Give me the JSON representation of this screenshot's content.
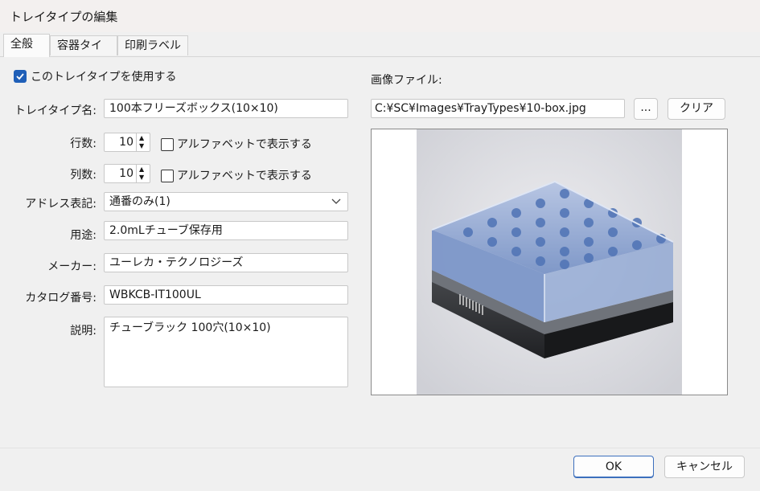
{
  "window": {
    "title": "トレイタイプの編集"
  },
  "tabs": [
    {
      "label": "全般",
      "active": true
    },
    {
      "label": "容器タイプ",
      "active": false
    },
    {
      "label": "印刷ラベル",
      "active": false
    }
  ],
  "general": {
    "use_tray_type": {
      "label": "このトレイタイプを使用する",
      "checked": true
    },
    "fields": {
      "tray_type_name": {
        "label": "トレイタイプ名:",
        "value": "100本フリーズボックス(10×10)"
      },
      "rows": {
        "label": "行数:",
        "value": "10",
        "alpha_label": "アルファベットで表示する",
        "alpha_checked": false
      },
      "columns": {
        "label": "列数:",
        "value": "10",
        "alpha_label": "アルファベットで表示する",
        "alpha_checked": false
      },
      "address_notation": {
        "label": "アドレス表記:",
        "value": "通番のみ(1)"
      },
      "usage": {
        "label": "用途:",
        "value": "2.0mLチューブ保存用"
      },
      "maker": {
        "label": "メーカー:",
        "value": "ユーレカ・テクノロジーズ"
      },
      "catalog_no": {
        "label": "カタログ番号:",
        "value": "WBKCB-IT100UL"
      },
      "description": {
        "label": "説明:",
        "value": "チューブラック 100穴(10×10)"
      }
    },
    "image": {
      "label": "画像ファイル:",
      "path": "C:¥SC¥Images¥TrayTypes¥10-box.jpg",
      "browse_label": "...",
      "clear_label": "クリア"
    }
  },
  "footer": {
    "ok_label": "OK",
    "cancel_label": "キャンセル"
  },
  "colors": {
    "accent": "#1f5fb8",
    "tube_blue": "#6f92c8",
    "box_dark": "#2f3033"
  }
}
